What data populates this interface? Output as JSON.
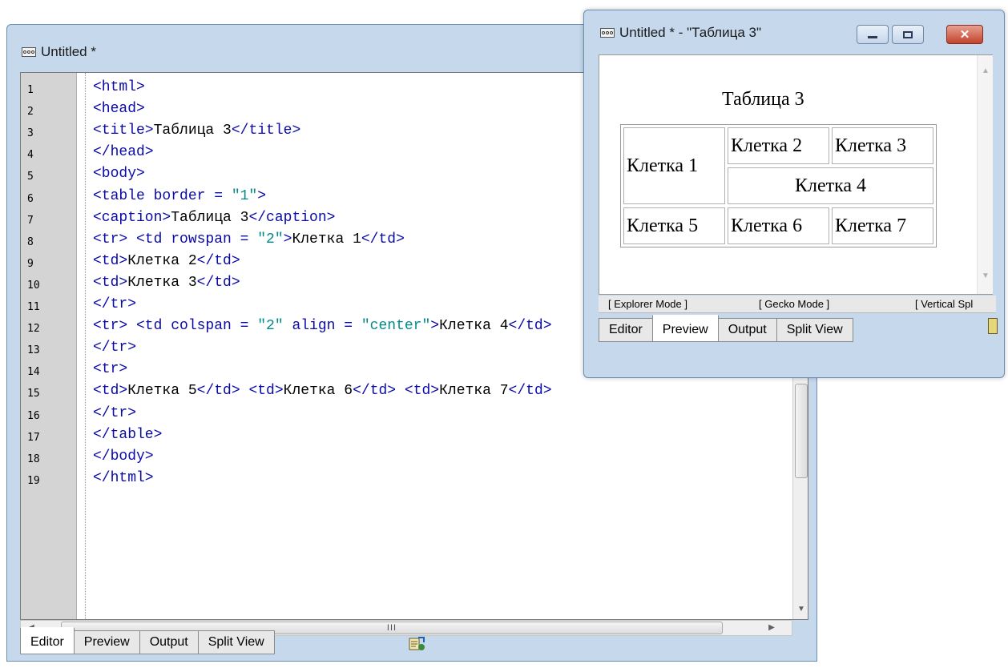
{
  "editor": {
    "title": "Untitled *",
    "lines": [
      {
        "n": "1",
        "parts": [
          {
            "t": "<html>",
            "c": "tg"
          }
        ]
      },
      {
        "n": "2",
        "parts": [
          {
            "t": "<head>",
            "c": "tg"
          }
        ]
      },
      {
        "n": "3",
        "parts": [
          {
            "t": "<title>",
            "c": "tg"
          },
          {
            "t": "Таблица 3",
            "c": "tx"
          },
          {
            "t": "</title>",
            "c": "tg"
          }
        ]
      },
      {
        "n": "4",
        "parts": [
          {
            "t": "</head>",
            "c": "tg"
          }
        ]
      },
      {
        "n": "5",
        "parts": [
          {
            "t": "<body>",
            "c": "tg"
          }
        ]
      },
      {
        "n": "6",
        "parts": [
          {
            "t": "<table border = ",
            "c": "tg"
          },
          {
            "t": "\"1\"",
            "c": "st"
          },
          {
            "t": ">",
            "c": "tg"
          }
        ]
      },
      {
        "n": "7",
        "parts": [
          {
            "t": "<caption>",
            "c": "tg"
          },
          {
            "t": "Таблица 3",
            "c": "tx"
          },
          {
            "t": "</caption>",
            "c": "tg"
          }
        ]
      },
      {
        "n": "8",
        "parts": [
          {
            "t": "<tr> <td rowspan = ",
            "c": "tg"
          },
          {
            "t": "\"2\"",
            "c": "st"
          },
          {
            "t": ">",
            "c": "tg"
          },
          {
            "t": "Клетка 1",
            "c": "tx"
          },
          {
            "t": "</td>",
            "c": "tg"
          }
        ]
      },
      {
        "n": "9",
        "parts": [
          {
            "t": "<td>",
            "c": "tg"
          },
          {
            "t": "Клетка 2",
            "c": "tx"
          },
          {
            "t": "</td>",
            "c": "tg"
          }
        ]
      },
      {
        "n": "10",
        "parts": [
          {
            "t": "<td>",
            "c": "tg"
          },
          {
            "t": "Клетка 3",
            "c": "tx"
          },
          {
            "t": "</td>",
            "c": "tg"
          }
        ]
      },
      {
        "n": "11",
        "parts": [
          {
            "t": "</tr>",
            "c": "tg"
          }
        ]
      },
      {
        "n": "12",
        "parts": [
          {
            "t": "<tr> <td colspan = ",
            "c": "tg"
          },
          {
            "t": "\"2\"",
            "c": "st"
          },
          {
            "t": " align = ",
            "c": "tg"
          },
          {
            "t": "\"center\"",
            "c": "st"
          },
          {
            "t": ">",
            "c": "tg"
          },
          {
            "t": "Клетка 4",
            "c": "tx"
          },
          {
            "t": "</td>",
            "c": "tg"
          }
        ]
      },
      {
        "n": "13",
        "parts": [
          {
            "t": "</tr>",
            "c": "tg"
          }
        ]
      },
      {
        "n": "14",
        "parts": [
          {
            "t": "<tr>",
            "c": "tg"
          }
        ]
      },
      {
        "n": "15",
        "parts": [
          {
            "t": "<td>",
            "c": "tg"
          },
          {
            "t": "Клетка 5",
            "c": "tx"
          },
          {
            "t": "</td> <td>",
            "c": "tg"
          },
          {
            "t": "Клетка 6",
            "c": "tx"
          },
          {
            "t": "</td> <td>",
            "c": "tg"
          },
          {
            "t": "Клетка 7",
            "c": "tx"
          },
          {
            "t": "</td>",
            "c": "tg"
          }
        ]
      },
      {
        "n": "16",
        "parts": [
          {
            "t": "</tr>",
            "c": "tg"
          }
        ]
      },
      {
        "n": "17",
        "parts": [
          {
            "t": "</table>",
            "c": "tg"
          }
        ]
      },
      {
        "n": "18",
        "parts": [
          {
            "t": "</body>",
            "c": "tg"
          }
        ]
      },
      {
        "n": "19",
        "parts": [
          {
            "t": "</html>",
            "c": "tg"
          }
        ]
      }
    ],
    "hscroll_grip": "III",
    "tabs": {
      "editor": "Editor",
      "preview": "Preview",
      "output": "Output",
      "split_view": "Split View"
    }
  },
  "preview": {
    "title": "Untitled * - \"Таблица 3\"",
    "caption": "Таблица 3",
    "cells": {
      "c1": "Клетка 1",
      "c2": "Клетка 2",
      "c3": "Клетка 3",
      "c4": "Клетка 4",
      "c5": "Клетка 5",
      "c6": "Клетка 6",
      "c7": "Клетка 7"
    },
    "modes": {
      "explorer": "[ Explorer Mode ]",
      "gecko": "[ Gecko Mode ]",
      "vertical": "[ Vertical Spl"
    },
    "tabs": {
      "editor": "Editor",
      "preview": "Preview",
      "output": "Output",
      "split_view": "Split View"
    }
  },
  "colors": {
    "tag": "#0a0aa8",
    "string": "#008b8b",
    "text": "#000000",
    "chrome": "#c5d8ec"
  }
}
